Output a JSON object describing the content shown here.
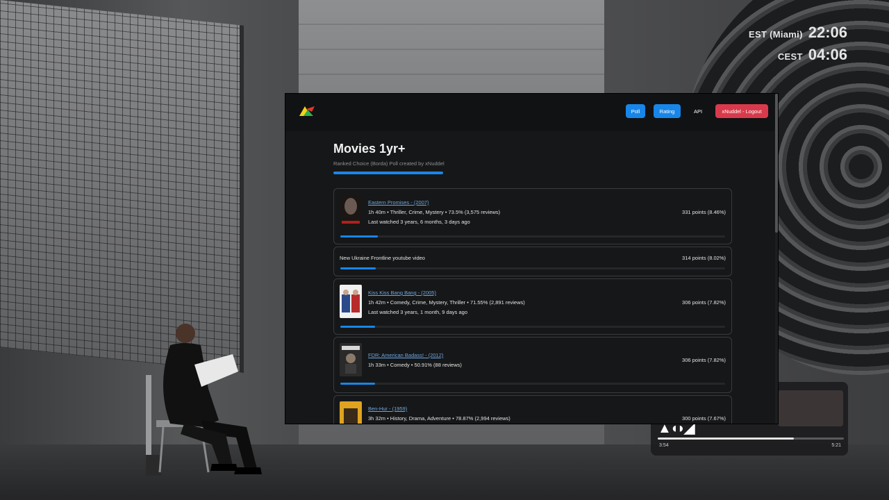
{
  "clock": [
    {
      "zone": "EST (Miami)",
      "time": "22:06"
    },
    {
      "zone": "CEST",
      "time": "04:06"
    }
  ],
  "media_player": {
    "elapsed": "3:54",
    "total": "5:21",
    "progress": 0.73
  },
  "header": {
    "buttons": {
      "poll": "Poll",
      "rating": "Rating",
      "api": "API",
      "logout": "xNuddel - Logout"
    },
    "accent": "#1886e8",
    "danger": "#d93a4b"
  },
  "poll": {
    "title": "Movies 1yr+",
    "subtitle": "Ranked Choice (Borda) Poll created by xNuddel",
    "items": [
      {
        "title": "Eastern Promises - (2007)",
        "meta": "1h 40m • Thriller, Crime, Mystery • 73.5% (3,575 reviews)",
        "last_watched": "Last watched 3 years, 6 months, 3 days ago",
        "points": "331 points (8.46%)",
        "share": 8.46,
        "poster_icon": "eastern-promises-poster"
      },
      {
        "title": "New Ukraine Frontline youtube video",
        "points": "314 points (8.02%)",
        "share": 8.02
      },
      {
        "title": "Kiss Kiss Bang Bang - (2005)",
        "meta": "1h 42m • Comedy, Crime, Mystery, Thriller • 71.55% (2,891 reviews)",
        "last_watched": "Last watched 3 years, 1 month, 9 days ago",
        "points": "306 points (7.82%)",
        "share": 7.82,
        "poster_icon": "kiss-kiss-bang-bang-poster"
      },
      {
        "title": "FDR: American Badass! - (2012)",
        "meta": "1h 33m • Comedy • 50.91% (88 reviews)",
        "points": "306 points (7.82%)",
        "share": 7.82,
        "poster_icon": "fdr-american-badass-poster"
      },
      {
        "title": "Ben-Hur - (1959)",
        "meta": "3h 32m • History, Drama, Adventure • 78.87% (2,994 reviews)",
        "points": "300 points (7.67%)",
        "share": 7.67,
        "poster_icon": "ben-hur-poster"
      }
    ]
  }
}
